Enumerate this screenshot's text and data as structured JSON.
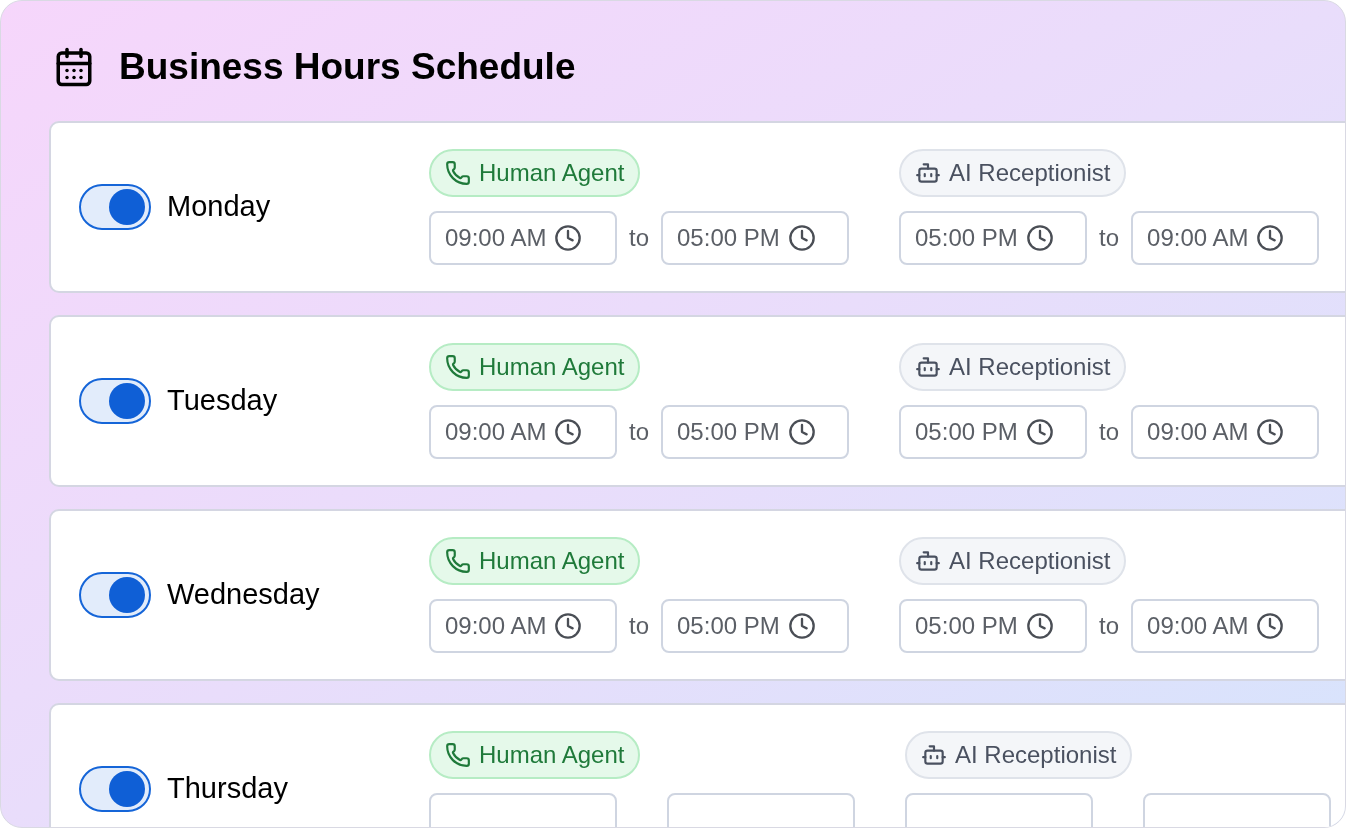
{
  "title": "Business Hours Schedule",
  "days": [
    {
      "name": "Monday",
      "enabled": true,
      "slots": [
        {
          "kind": "human",
          "label": "Human Agent",
          "from": "09:00 AM",
          "joiner": "to",
          "until": "05:00 PM"
        },
        {
          "kind": "ai",
          "label": "AI Receptionist",
          "from": "05:00 PM",
          "joiner": "to",
          "until": "09:00 AM"
        }
      ]
    },
    {
      "name": "Tuesday",
      "enabled": true,
      "slots": [
        {
          "kind": "human",
          "label": "Human Agent",
          "from": "09:00 AM",
          "joiner": "to",
          "until": "05:00 PM"
        },
        {
          "kind": "ai",
          "label": "AI Receptionist",
          "from": "05:00 PM",
          "joiner": "to",
          "until": "09:00 AM"
        }
      ]
    },
    {
      "name": "Wednesday",
      "enabled": true,
      "slots": [
        {
          "kind": "human",
          "label": "Human Agent",
          "from": "09:00 AM",
          "joiner": "to",
          "until": "05:00 PM"
        },
        {
          "kind": "ai",
          "label": "AI Receptionist",
          "from": "05:00 PM",
          "joiner": "to",
          "until": "09:00 AM"
        }
      ]
    },
    {
      "name": "Thursday",
      "enabled": true,
      "slots": [
        {
          "kind": "human",
          "label": "Human Agent"
        },
        {
          "kind": "ai",
          "label": "AI Receptionist"
        }
      ]
    }
  ]
}
